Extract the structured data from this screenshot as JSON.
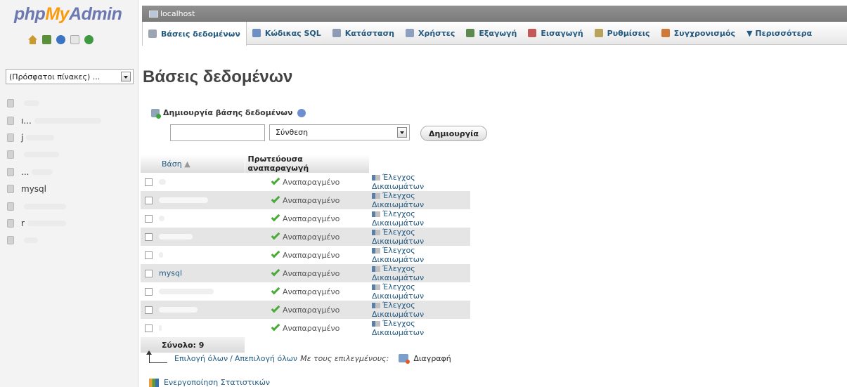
{
  "logo": {
    "php": "php",
    "my": "My",
    "admin": "Admin"
  },
  "quicklinks": [
    "home-icon",
    "logout-icon",
    "help-icon",
    "docs-icon",
    "reload-icon"
  ],
  "sidebar": {
    "recent_tables": "(Πρόσφατοι πίνακες) ...",
    "databases": [
      {
        "label": ""
      },
      {
        "label": "ı..."
      },
      {
        "label": "j"
      },
      {
        "label": ""
      },
      {
        "label": "..."
      },
      {
        "label": "mysql"
      },
      {
        "label": ""
      },
      {
        "label": "r"
      },
      {
        "label": ""
      }
    ]
  },
  "server": {
    "label": "localhost"
  },
  "tabs": [
    {
      "label": "Βάσεις δεδομένων",
      "icon": "database-icon",
      "color": "#9aa5b1",
      "active": true
    },
    {
      "label": "Κώδικας SQL",
      "icon": "sql-icon",
      "color": "#6f8fc4"
    },
    {
      "label": "Κατάσταση",
      "icon": "status-icon",
      "color": "#8e9cb3"
    },
    {
      "label": "Χρήστες",
      "icon": "users-icon",
      "color": "#8ea0c0"
    },
    {
      "label": "Εξαγωγή",
      "icon": "export-icon",
      "color": "#5f8a4f"
    },
    {
      "label": "Εισαγωγή",
      "icon": "import-icon",
      "color": "#c45858"
    },
    {
      "label": "Ρυθμίσεις",
      "icon": "settings-icon",
      "color": "#b8a25c"
    },
    {
      "label": "Συγχρονισμός",
      "icon": "sync-icon",
      "color": "#d07a3a"
    },
    {
      "label": "▼ Περισσότερα",
      "icon": "",
      "color": ""
    }
  ],
  "main": {
    "title": "Βάσεις δεδομένων",
    "create": {
      "heading": "Δημιουργία βάσης δεδομένων",
      "name_value": "",
      "collation": "Σύνθεση",
      "button": "Δημιουργία"
    },
    "table": {
      "headers": {
        "db": "Βάση",
        "replication": "Πρωτεύουσα αναπαραγωγή"
      },
      "rows": [
        {
          "name": "",
          "replication": "Αναπαραγμένο",
          "privileges": "Έλεγχος Δικαιωμάτων"
        },
        {
          "name": "",
          "replication": "Αναπαραγμένο",
          "privileges": "Έλεγχος Δικαιωμάτων"
        },
        {
          "name": "",
          "replication": "Αναπαραγμένο",
          "privileges": "Έλεγχος Δικαιωμάτων"
        },
        {
          "name": "",
          "replication": "Αναπαραγμένο",
          "privileges": "Έλεγχος Δικαιωμάτων"
        },
        {
          "name": "",
          "replication": "Αναπαραγμένο",
          "privileges": "Έλεγχος Δικαιωμάτων"
        },
        {
          "name": "mysql",
          "replication": "Αναπαραγμένο",
          "privileges": "Έλεγχος Δικαιωμάτων"
        },
        {
          "name": "",
          "replication": "Αναπαραγμένο",
          "privileges": "Έλεγχος Δικαιωμάτων"
        },
        {
          "name": "",
          "replication": "Αναπαραγμένο",
          "privileges": "Έλεγχος Δικαιωμάτων"
        },
        {
          "name": "",
          "replication": "Αναπαραγμένο",
          "privileges": "Έλεγχος Δικαιωμάτων"
        }
      ],
      "total": "Σύνολο: 9"
    },
    "footer": {
      "check_all": "Επιλογή όλων",
      "separator": "/",
      "uncheck_all": "Απεπιλογή όλων",
      "with_selected": "Με τους επιλεγμένους:",
      "drop": "Διαγραφή",
      "enable_stats": "Ενεργοποίηση Στατιστικών"
    }
  }
}
